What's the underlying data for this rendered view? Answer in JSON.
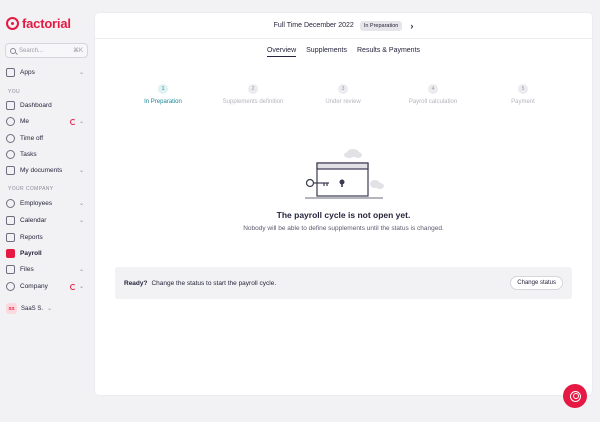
{
  "brand": {
    "name": "factorial",
    "accent": "#e51943"
  },
  "search": {
    "placeholder": "Search...",
    "shortcut": "⌘K"
  },
  "sidebar": {
    "apps": "Apps",
    "section_you": "YOU",
    "you_items": [
      "Dashboard",
      "Me",
      "Time off",
      "Tasks",
      "My documents"
    ],
    "section_company": "YOUR COMPANY",
    "company_items": [
      "Employees",
      "Calendar",
      "Reports",
      "Payroll",
      "Files",
      "Company"
    ],
    "active_item": "Payroll",
    "company_switcher": {
      "initials": "SS",
      "name": "SaaS S."
    }
  },
  "header": {
    "period": "Full Time December 2022",
    "status_badge": "In Preparation"
  },
  "tabs": [
    {
      "label": "Overview",
      "active": true
    },
    {
      "label": "Supplements",
      "active": false
    },
    {
      "label": "Results & Payments",
      "active": false
    }
  ],
  "steps": [
    {
      "num": "1",
      "label": "In Preparation",
      "active": true
    },
    {
      "num": "2",
      "label": "Supplements definition",
      "active": false
    },
    {
      "num": "3",
      "label": "Under review",
      "active": false
    },
    {
      "num": "4",
      "label": "Payroll calculation",
      "active": false
    },
    {
      "num": "5",
      "label": "Payment",
      "active": false
    }
  ],
  "empty_state": {
    "title": "The payroll cycle is not open yet.",
    "subtitle": "Nobody will be able to define supplements until the status is changed."
  },
  "ready_bar": {
    "label": "Ready?",
    "message": "Change the status to start the payroll cycle.",
    "button": "Change status"
  }
}
